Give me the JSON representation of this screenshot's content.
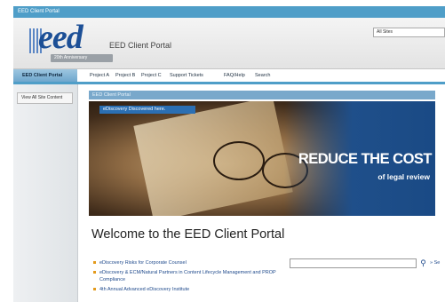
{
  "window": {
    "title": "EED Client Portal"
  },
  "header": {
    "logo_text": "eed",
    "logo_ribbon": "20th Anniversary",
    "portal_title": "EED Client Portal",
    "site_scope": "All Sites"
  },
  "nav": {
    "home": "EED Client Portal",
    "items": [
      "Project A",
      "Project B",
      "Project C",
      "Support Tickets",
      "FAQ/Help",
      "Search"
    ]
  },
  "sidebar": {
    "view_all": "View All Site Content"
  },
  "breadcrumb": "EED Client Portal",
  "banner": {
    "tag": "eDiscovery Discovered here.",
    "headline": "REDUCE THE COST",
    "subline": "of legal review"
  },
  "main": {
    "welcome": "Welcome to the EED Client Portal",
    "links": [
      "eDiscovery Risks for Corporate Counsel",
      "eDiscovery & ECM/Natural Partners in Content Lifecycle Management and PROP Compliance",
      "4th Annual Advanced eDiscovery Institute"
    ],
    "search_more": "» Se"
  }
}
